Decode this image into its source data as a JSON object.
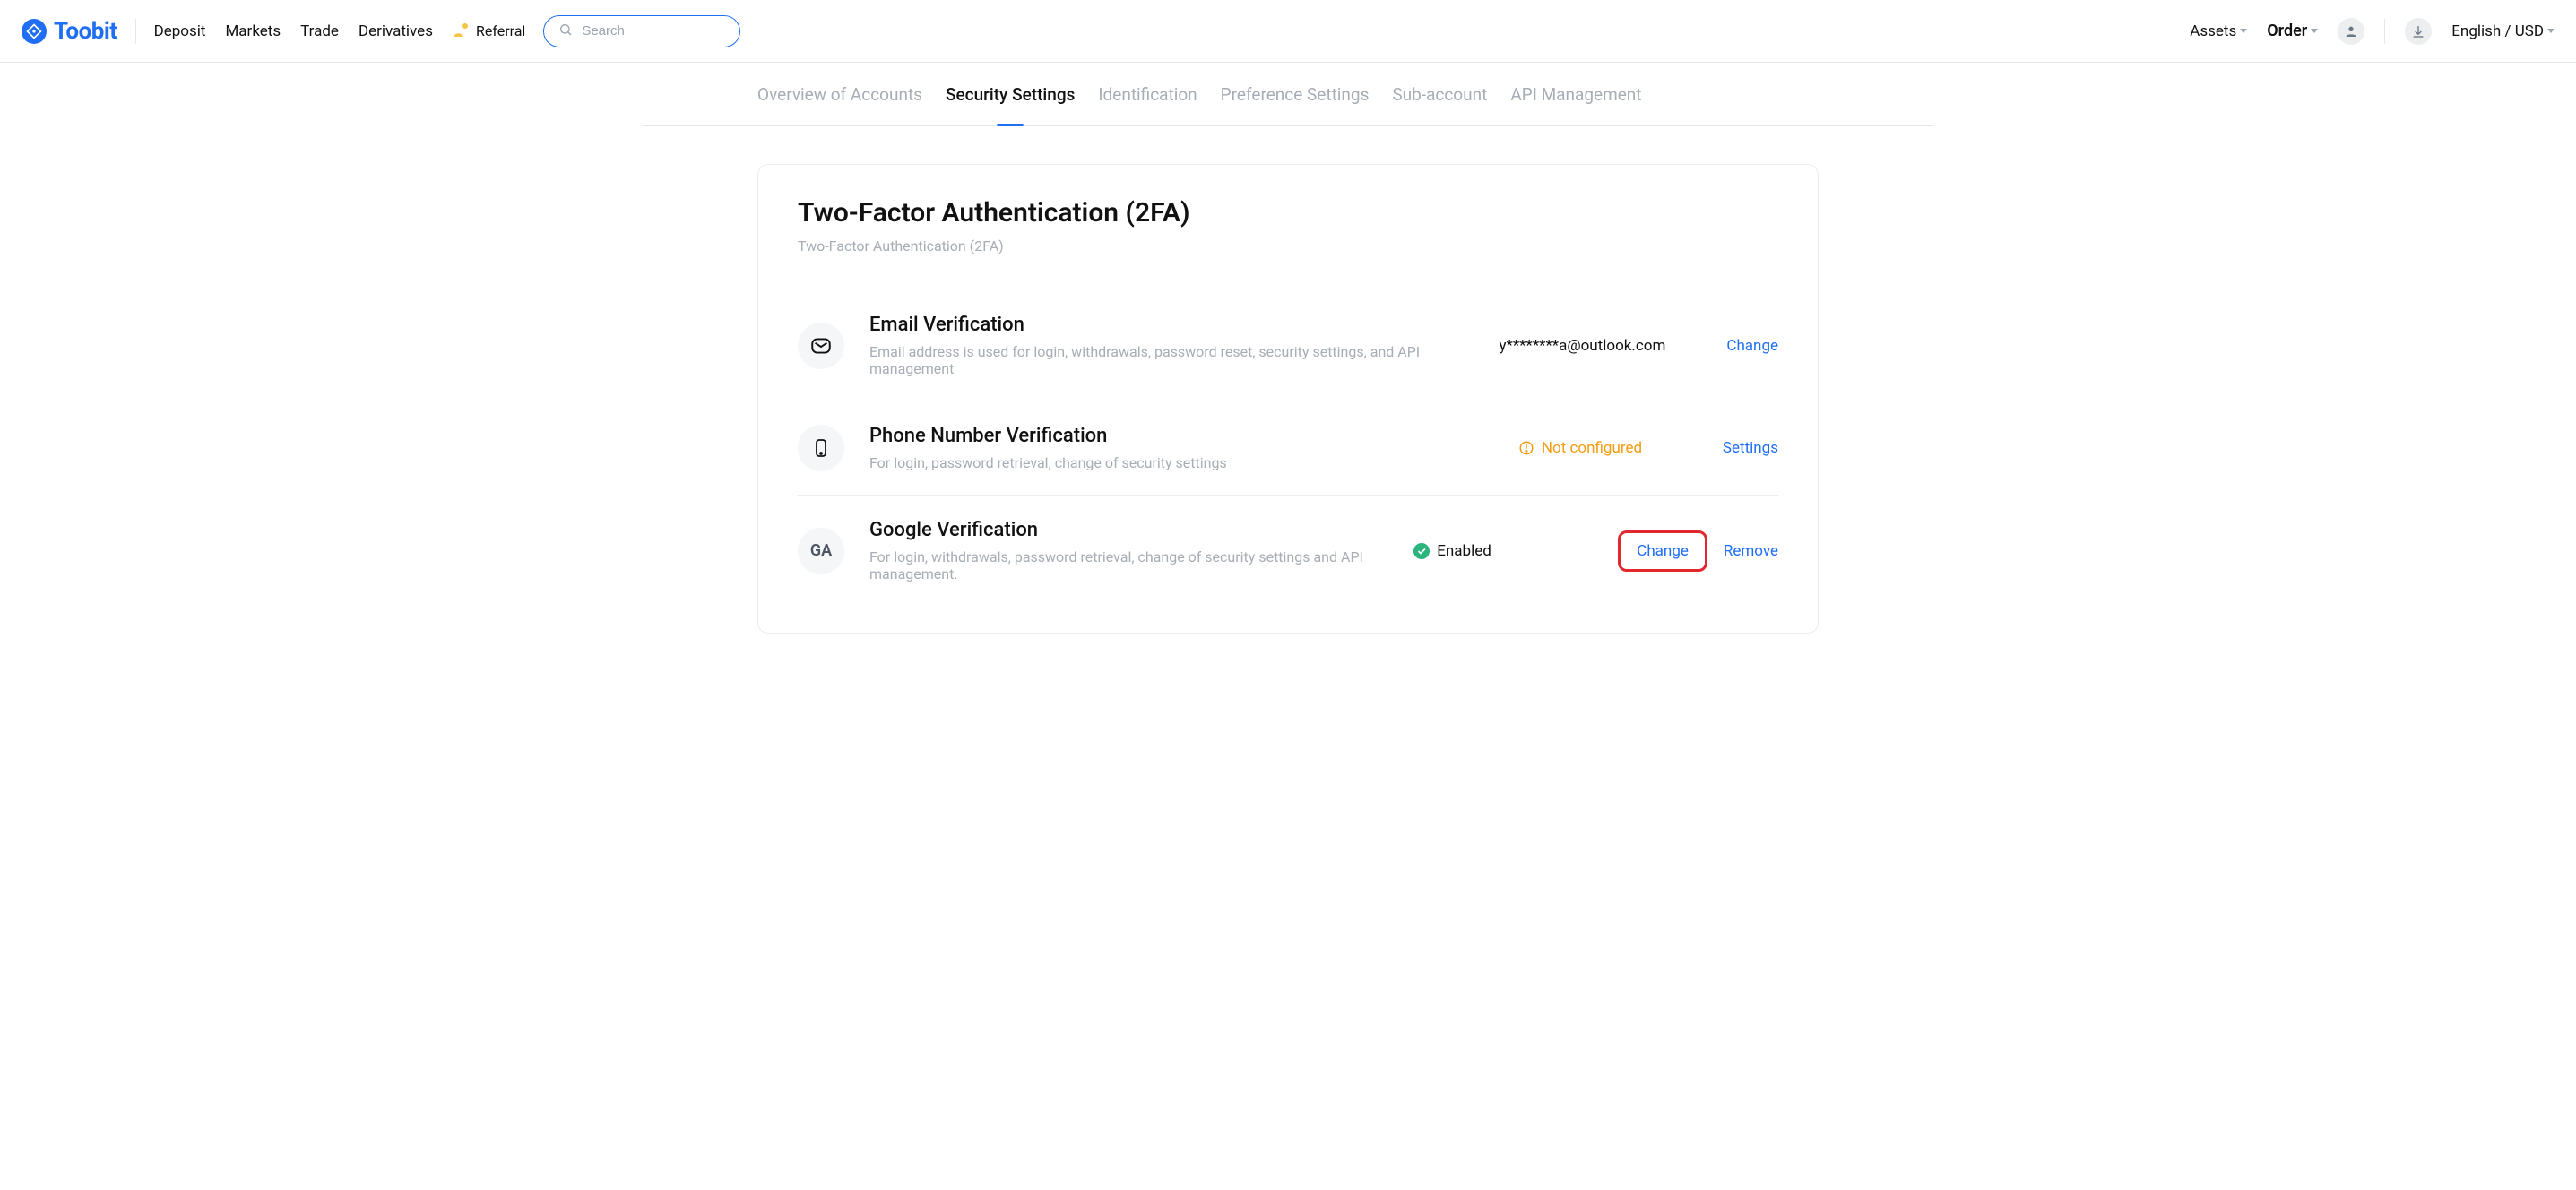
{
  "brand": {
    "name": "Toobit"
  },
  "nav": {
    "deposit": "Deposit",
    "markets": "Markets",
    "trade": "Trade",
    "derivatives": "Derivatives",
    "referral": "Referral"
  },
  "search": {
    "placeholder": "Search"
  },
  "header_right": {
    "assets": "Assets",
    "order": "Order",
    "locale": "English / USD"
  },
  "tabs": {
    "overview": "Overview of Accounts",
    "security": "Security Settings",
    "identification": "Identification",
    "preference": "Preference Settings",
    "sub": "Sub-account",
    "api": "API Management"
  },
  "card": {
    "title": "Two-Factor Authentication (2FA)",
    "subtitle": "Two-Factor Authentication (2FA)"
  },
  "rows": {
    "email": {
      "title": "Email Verification",
      "desc": "Email address is used for login, withdrawals, password reset, security settings, and API management",
      "value": "y********a@outlook.com",
      "action_change": "Change"
    },
    "phone": {
      "title": "Phone Number Verification",
      "desc": "For login, password retrieval, change of security settings",
      "status": "Not configured",
      "action_settings": "Settings"
    },
    "google": {
      "title": "Google Verification",
      "desc": "For login, withdrawals, password retrieval, change of security settings and API management.",
      "ga": "GA",
      "status": "Enabled",
      "action_change": "Change",
      "action_remove": "Remove"
    }
  },
  "colors": {
    "accent": "#206ef4",
    "warn": "#f39c12",
    "success": "#2ab57d",
    "highlight": "#e0282e"
  }
}
